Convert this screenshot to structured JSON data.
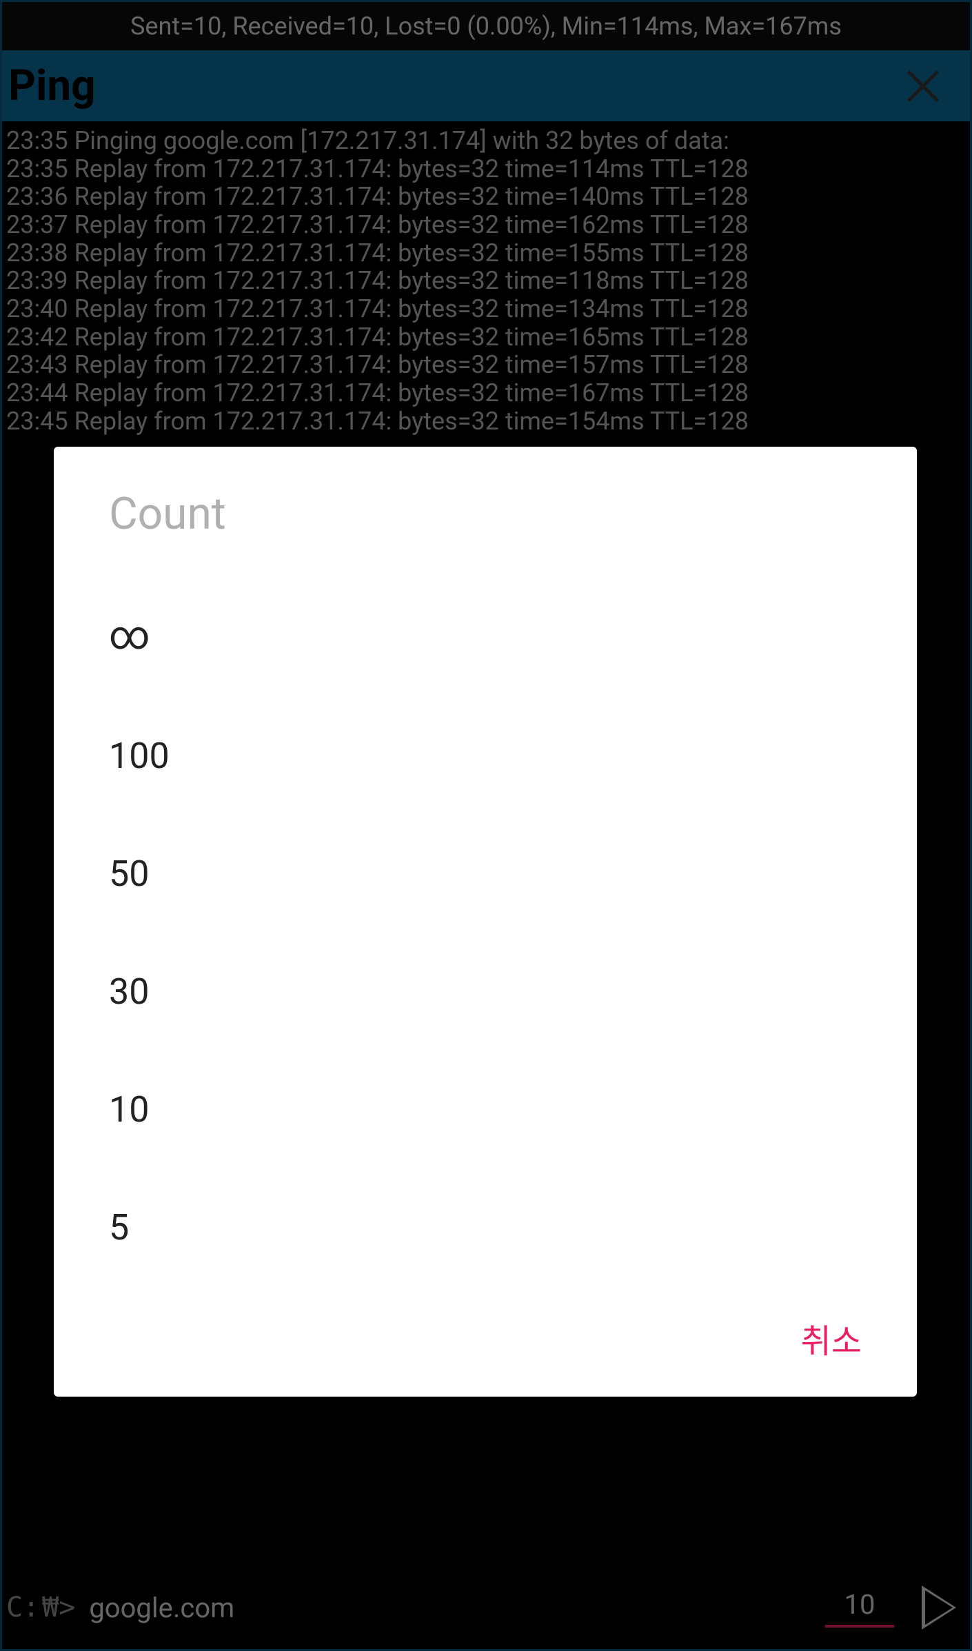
{
  "status": {
    "stats": "Sent=10, Received=10, Lost=0 (0.00%), Min=114ms, Max=167ms"
  },
  "title_bar": {
    "title": "Ping"
  },
  "terminal": {
    "lines": [
      "23:35 Pinging google.com [172.217.31.174] with 32 bytes of data:",
      "23:35 Replay from 172.217.31.174: bytes=32 time=114ms TTL=128",
      "23:36 Replay from 172.217.31.174: bytes=32 time=140ms TTL=128",
      "23:37 Replay from 172.217.31.174: bytes=32 time=162ms TTL=128",
      "23:38 Replay from 172.217.31.174: bytes=32 time=155ms TTL=128",
      "23:39 Replay from 172.217.31.174: bytes=32 time=118ms TTL=128",
      "23:40 Replay from 172.217.31.174: bytes=32 time=134ms TTL=128",
      "23:42 Replay from 172.217.31.174: bytes=32 time=165ms TTL=128",
      "23:43 Replay from 172.217.31.174: bytes=32 time=157ms TTL=128",
      "23:44 Replay from 172.217.31.174: bytes=32 time=167ms TTL=128",
      "23:45 Replay from 172.217.31.174: bytes=32 time=154ms TTL=128"
    ]
  },
  "bottom_bar": {
    "prompt": "C:",
    "won": "₩>",
    "host": "google.com",
    "count": "10"
  },
  "dialog": {
    "title": "Count",
    "options": [
      "∞",
      "100",
      "50",
      "30",
      "10",
      "5"
    ],
    "cancel": "취소"
  }
}
